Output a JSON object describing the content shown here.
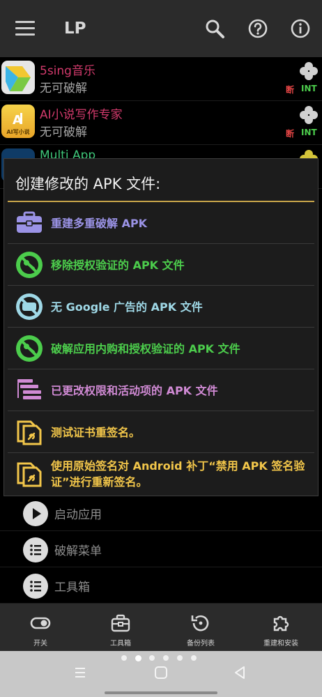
{
  "appbar": {
    "title": "LP",
    "icons": [
      "menu-icon",
      "search-icon",
      "help-icon",
      "info-icon"
    ]
  },
  "apps": [
    {
      "name": "5sing音乐",
      "status": "无可破解",
      "name_color": "#d23a6c",
      "tag_red": "断",
      "tag_green": "INT",
      "clover_color": "#d0d0d0"
    },
    {
      "name": "AI小说写作专家",
      "status": "无可破解",
      "name_color": "#d23a6c",
      "tag_red": "断",
      "tag_green": "INT",
      "clover_color": "#d0d0d0"
    },
    {
      "name": "Multi App",
      "status": "",
      "name_color": "#3fc77a",
      "tag_red": "",
      "tag_green": "",
      "clover_color": "#d4c43a"
    }
  ],
  "app_icon_texts": {
    "ai_icon": "AI写小说"
  },
  "dialog": {
    "title": "创建修改的 APK 文件:",
    "options": [
      {
        "label": "重建多重破解 APK",
        "color": "#9b93e6",
        "icon": "toolbox-icon"
      },
      {
        "label": "移除授权验证的 APK 文件",
        "color": "#4ccd4c",
        "icon": "no-license-icon"
      },
      {
        "label": "无 Google 广告的 APK 文件",
        "color": "#9fd8e6",
        "icon": "no-ads-icon"
      },
      {
        "label": "破解应用内购和授权验证的 APK 文件",
        "color": "#4ccd4c",
        "icon": "no-license-icon"
      },
      {
        "label": "已更改权限和活动项的 APK 文件",
        "color": "#d08ad4",
        "icon": "permissions-icon"
      },
      {
        "label": "测试证书重签名。",
        "color": "#f2c64a",
        "icon": "resign-icon"
      },
      {
        "label": "使用原始签名对 Android 补丁“禁用 APK 签名验证”进行重新签名。",
        "color": "#f2c64a",
        "icon": "resign-icon"
      }
    ]
  },
  "lower_menu": [
    {
      "label": "启动应用",
      "icon": "play-icon"
    },
    {
      "label": "破解菜单",
      "icon": "list-icon"
    },
    {
      "label": "工具箱",
      "icon": "list-icon"
    }
  ],
  "bottom_nav": [
    {
      "label": "开关",
      "icon": "toggle-icon"
    },
    {
      "label": "工具箱",
      "icon": "toolbox-icon"
    },
    {
      "label": "备份列表",
      "icon": "backup-icon"
    },
    {
      "label": "重建和安装",
      "icon": "puzzle-icon"
    }
  ],
  "pager": {
    "count": 6,
    "active_index": 1
  },
  "system_nav": [
    "recents-icon",
    "home-icon",
    "back-icon"
  ]
}
